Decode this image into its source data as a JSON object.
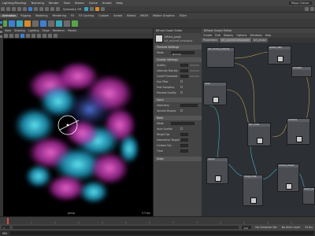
{
  "menubar": {
    "items": [
      "Lighting/Shading",
      "Texturing",
      "Render",
      "Toon",
      "Stereo",
      "Cache",
      "Arnold",
      "Help"
    ],
    "workspace_value": "Maya Classic"
  },
  "shelf": {
    "tabs": [
      "Animation",
      "Rigging",
      "Modeling",
      "Rendering",
      "FX",
      "FX Caching",
      "Custom",
      "Arnold",
      "Bifrost",
      "MASH",
      "Motion Graphics",
      "XGen"
    ],
    "active_tab": "Animation",
    "tool_value": "Symmetry: Off"
  },
  "viewport": {
    "menu": [
      "View",
      "Shading",
      "Lighting",
      "Show",
      "Renderer",
      "Panels"
    ],
    "camera_label": "persp",
    "fps": "5.3 fps",
    "colors": {
      "pink": "#e040c8",
      "cyan": "#2fd2e8",
      "blue": "#3a6dd8"
    }
  },
  "attr_editor": {
    "title": "Bifrost Graph Editor",
    "node_type": "bifrost_graph",
    "node_name": "bif_volumeCompositor",
    "sections": [
      "Preview Settings",
      "Quality Settings",
      "Input",
      "Bake",
      "Stats"
    ],
    "labels": [
      "Mode",
      "Quality",
      "Intensity Density",
      "Cutoff Threshold",
      "Use Filter",
      "Fast Sampling",
      "Preview Quality",
      "Geometry",
      "Volume Display",
      "Mode",
      "Auto Quality",
      "Target Fps",
      "Interactive Target Fps",
      "Custom Fps",
      "Time"
    ],
    "mode_value": "Normal"
  },
  "node_editor": {
    "title": "Bifrost Graph Editor",
    "menu": [
      "Create",
      "Edit",
      "Display",
      "Options",
      "Windows",
      "Help"
    ],
    "tabs": [
      "Parameters",
      "bif_volumeCompositor",
      "bif_smoke"
    ],
    "node_labels": [
      "set_volume_property",
      "sphere_data",
      "noise",
      "fbm_noise",
      "combine",
      "simulate",
      "output",
      "merge_data",
      "volume_shader",
      "vector_field"
    ]
  },
  "timeline": {
    "start": "1",
    "end": "120",
    "current": "1",
    "no_character_set": "No Character Set",
    "no_anim_layer": "No Anim Layer",
    "fps_label": "24 fps"
  },
  "command_line": {
    "label": "MEL"
  }
}
